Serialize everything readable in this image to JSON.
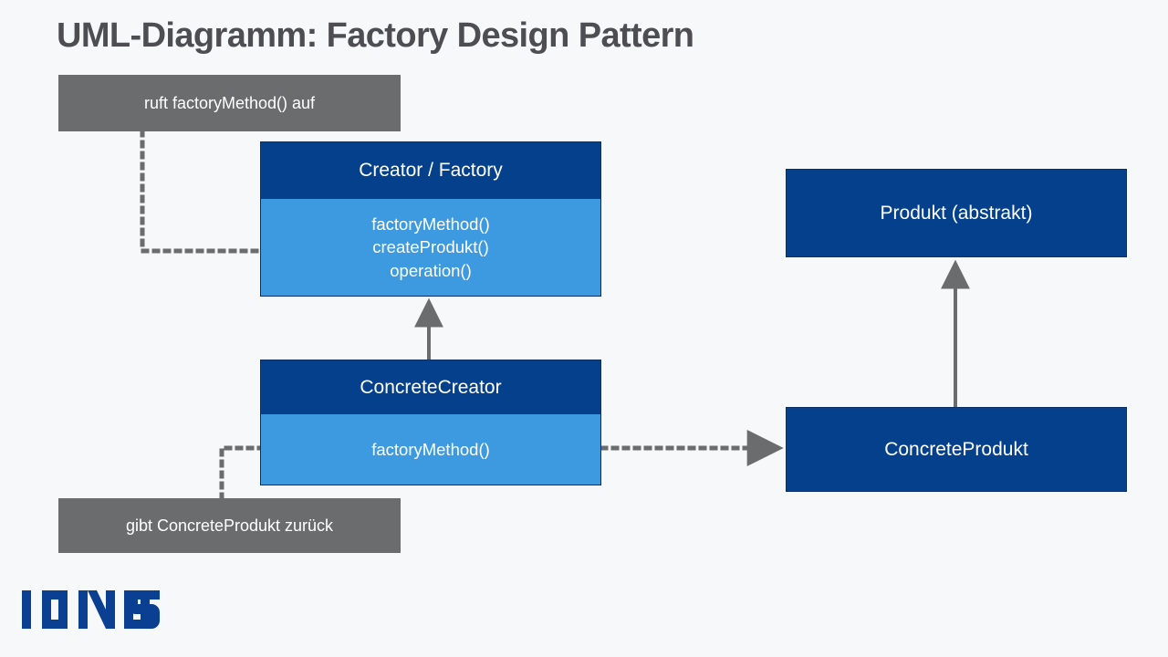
{
  "page": {
    "title": "UML-Diagramm: Factory Design Pattern",
    "background_color": "#f7f8fa",
    "title_color": "#4d4d52"
  },
  "colors": {
    "class_header": "#05408d",
    "class_body": "#3e9ae0",
    "note_background": "#6a6c6e",
    "connector": "#6a6c6e",
    "logo": "#0b3f91",
    "text_on_fill": "#ffffff"
  },
  "diagram": {
    "type": "uml-class-diagram",
    "classes": [
      {
        "id": "creator",
        "name": "Creator / Factory",
        "members": [
          "factoryMethod()",
          "createProdukt()",
          "operation()"
        ],
        "has_member_compartment": true
      },
      {
        "id": "concrete-creator",
        "name": "ConcreteCreator",
        "members": [
          "factoryMethod()"
        ],
        "has_member_compartment": true
      },
      {
        "id": "produkt",
        "name": "Produkt (abstrakt)",
        "members": [],
        "has_member_compartment": false
      },
      {
        "id": "concrete-produkt",
        "name": "ConcreteProdukt",
        "members": [],
        "has_member_compartment": false
      }
    ],
    "notes": [
      {
        "id": "note-calls",
        "text": "ruft factoryMethod() auf",
        "attached_to": "creator"
      },
      {
        "id": "note-returns",
        "text": "gibt ConcreteProdukt zurück",
        "attached_to": "concrete-creator"
      }
    ],
    "relations": [
      {
        "id": "rel-inherit-creator",
        "kind": "generalization",
        "style": "solid",
        "from": "concrete-creator",
        "to": "creator"
      },
      {
        "id": "rel-inherit-produkt",
        "kind": "generalization",
        "style": "solid",
        "from": "concrete-produkt",
        "to": "produkt"
      },
      {
        "id": "rel-creates",
        "kind": "dependency",
        "style": "dotted",
        "from": "concrete-creator",
        "to": "concrete-produkt"
      },
      {
        "id": "rel-note-calls",
        "kind": "note-anchor",
        "style": "dotted",
        "from": "note-calls",
        "to": "creator"
      },
      {
        "id": "rel-note-returns",
        "kind": "note-anchor",
        "style": "dotted",
        "from": "note-returns",
        "to": "concrete-creator"
      }
    ]
  },
  "footer": {
    "logo_text": "IONOS"
  }
}
